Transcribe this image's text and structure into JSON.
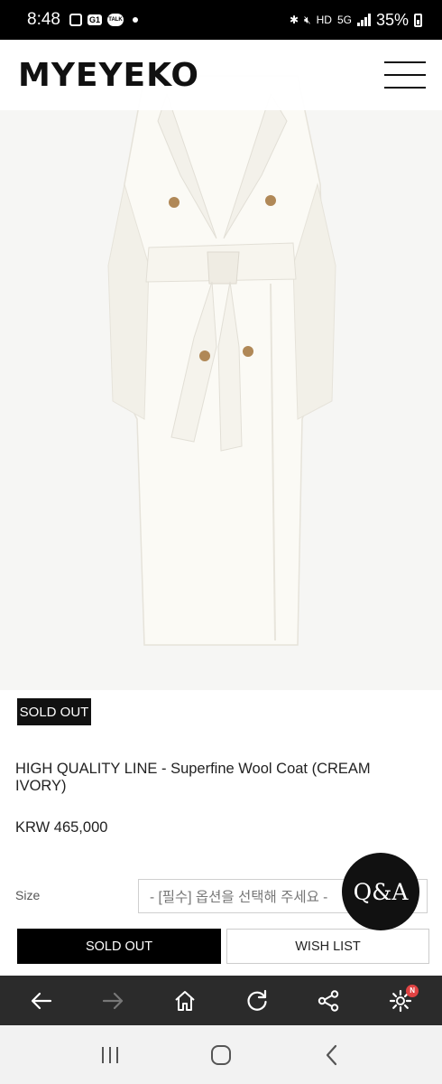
{
  "status_bar": {
    "time": "8:48",
    "network_label": "HD",
    "network_sub": "5G",
    "battery": "35%"
  },
  "header": {
    "brand": "MYEYEKO"
  },
  "product": {
    "badge": "SOLD OUT",
    "title": "HIGH QUALITY LINE - Superfine Wool Coat (CREAM IVORY)",
    "price": "KRW 465,000",
    "size_label": "Size",
    "size_placeholder": "- [필수] 옵션을 선택해 주세요 -"
  },
  "actions": {
    "sold_out": "SOLD OUT",
    "wish_list": "WISH LIST",
    "qa": "Q&A"
  },
  "browser_toolbar": {
    "badge": "N"
  },
  "colors": {
    "brand_black": "#111111",
    "toolbar_bg": "#2b2b2b",
    "notification": "#e04343"
  }
}
